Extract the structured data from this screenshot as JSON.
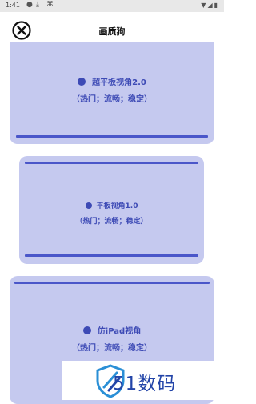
{
  "status": {
    "time": "1:41"
  },
  "header": {
    "title": "画质狗"
  },
  "options": [
    {
      "name": "超平板视角2.0",
      "desc": "（热门；流畅；稳定）"
    },
    {
      "name": "平板视角1.0",
      "desc": "（热门；流畅；稳定）"
    },
    {
      "name": "仿iPad视角",
      "desc": "（热门；流畅；稳定）"
    }
  ],
  "watermark": {
    "text": "51数码"
  },
  "colors": {
    "card": "#c5c9ef",
    "accent": "#3d4ab5",
    "bar": "#4a56c9"
  }
}
